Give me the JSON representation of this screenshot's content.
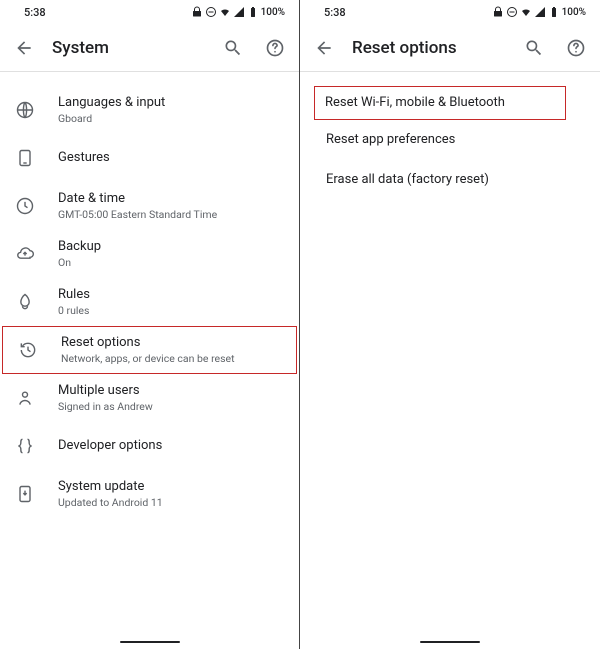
{
  "status": {
    "time": "5:38",
    "battery": "100%"
  },
  "left": {
    "title": "System",
    "items": [
      {
        "label": "Languages & input",
        "sub": "Gboard"
      },
      {
        "label": "Gestures",
        "sub": ""
      },
      {
        "label": "Date & time",
        "sub": "GMT-05:00 Eastern Standard Time"
      },
      {
        "label": "Backup",
        "sub": "On"
      },
      {
        "label": "Rules",
        "sub": "0 rules"
      },
      {
        "label": "Reset options",
        "sub": "Network, apps, or device can be reset"
      },
      {
        "label": "Multiple users",
        "sub": "Signed in as Andrew"
      },
      {
        "label": "Developer options",
        "sub": ""
      },
      {
        "label": "System update",
        "sub": "Updated to Android 11"
      }
    ]
  },
  "right": {
    "title": "Reset options",
    "items": [
      {
        "label": "Reset Wi-Fi, mobile & Bluetooth"
      },
      {
        "label": "Reset app preferences"
      },
      {
        "label": "Erase all data (factory reset)"
      }
    ]
  }
}
